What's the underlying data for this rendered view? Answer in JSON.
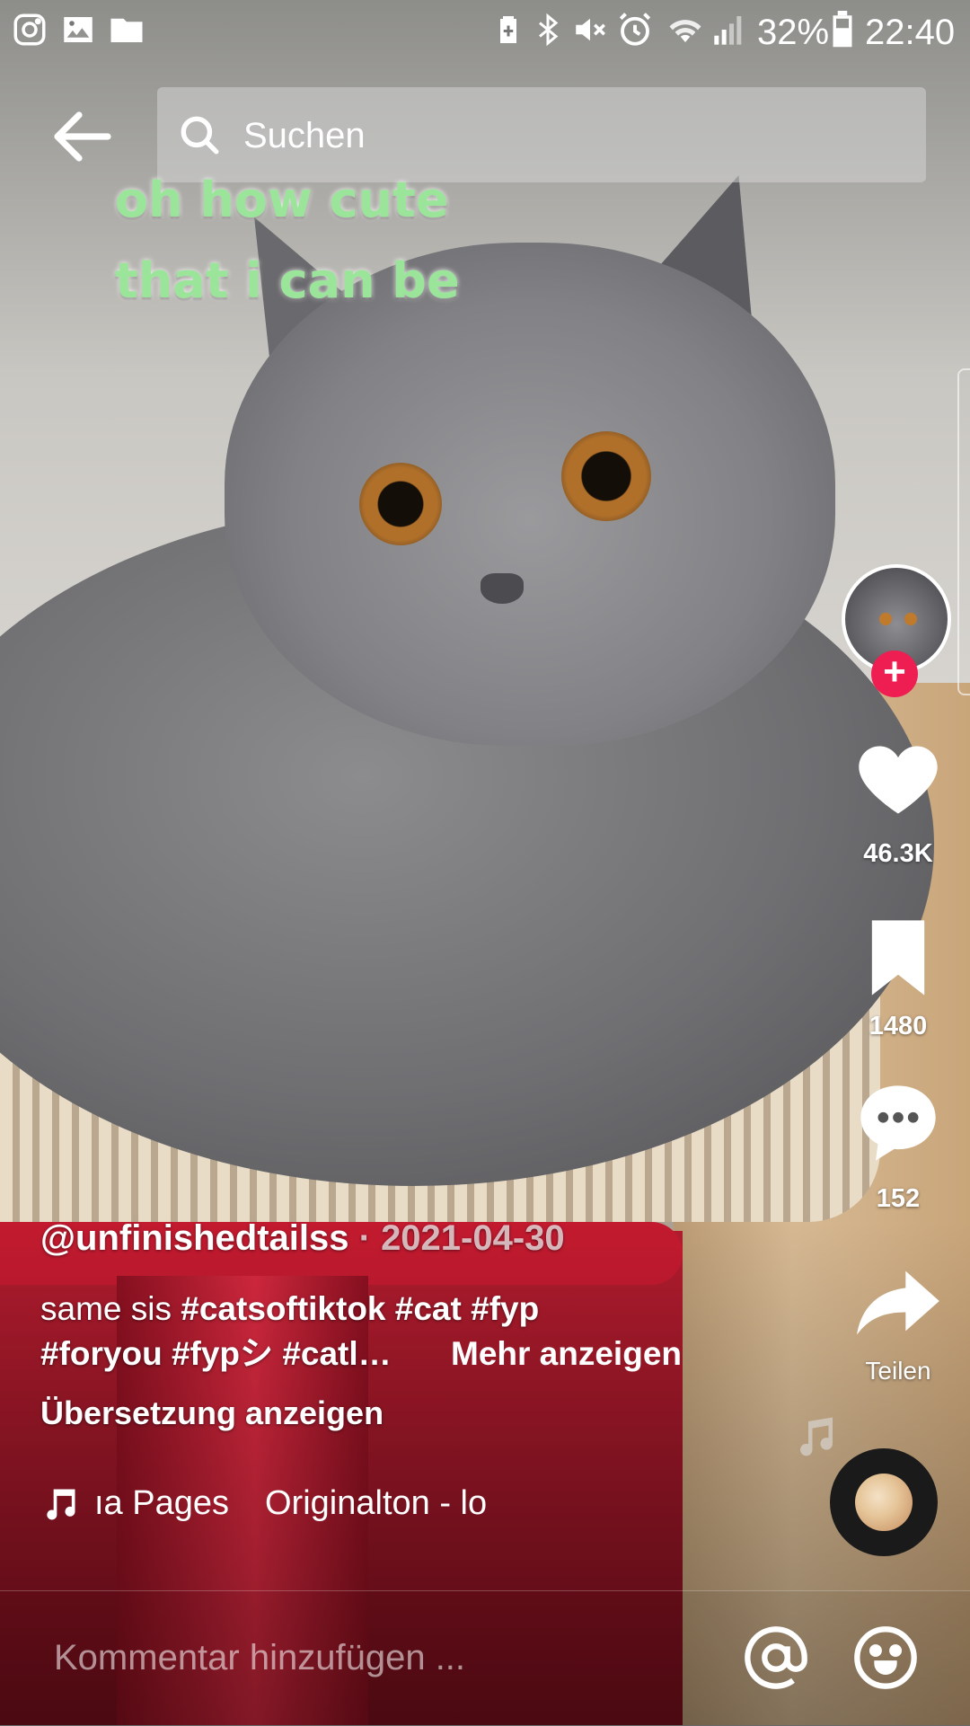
{
  "status_bar": {
    "left_icons": [
      "instagram-icon",
      "image-icon",
      "folder-icon"
    ],
    "right_icons": [
      "battery-saver-icon",
      "bluetooth-icon",
      "mute-icon",
      "alarm-icon",
      "wifi-icon",
      "signal-icon"
    ],
    "battery": "32%",
    "time": "22:40"
  },
  "top_bar": {
    "search_placeholder": "Suchen"
  },
  "video": {
    "overlay_line1": "oh how cute",
    "overlay_line2": "that i can be"
  },
  "actions": {
    "likes": "46.3K",
    "saves": "1480",
    "comments": "152",
    "share_label": "Teilen"
  },
  "post": {
    "author": "@unfinishedtailss",
    "date": "2021-04-30",
    "desc_line1_text": "same sis ",
    "desc_line1_tags": "#catsoftiktok #cat #fyp",
    "desc_line2_tags": "#foryou #fypシ #catl…",
    "more_label": "Mehr anzeigen",
    "translate_label": "Übersetzung anzeigen",
    "music_part1": "ıa Pages",
    "music_part2": "Originalton - lo"
  },
  "comment_bar": {
    "placeholder": "Kommentar hinzufügen ..."
  },
  "colors": {
    "accent": "#ee1d52",
    "overlay_text": "#9be59a"
  }
}
